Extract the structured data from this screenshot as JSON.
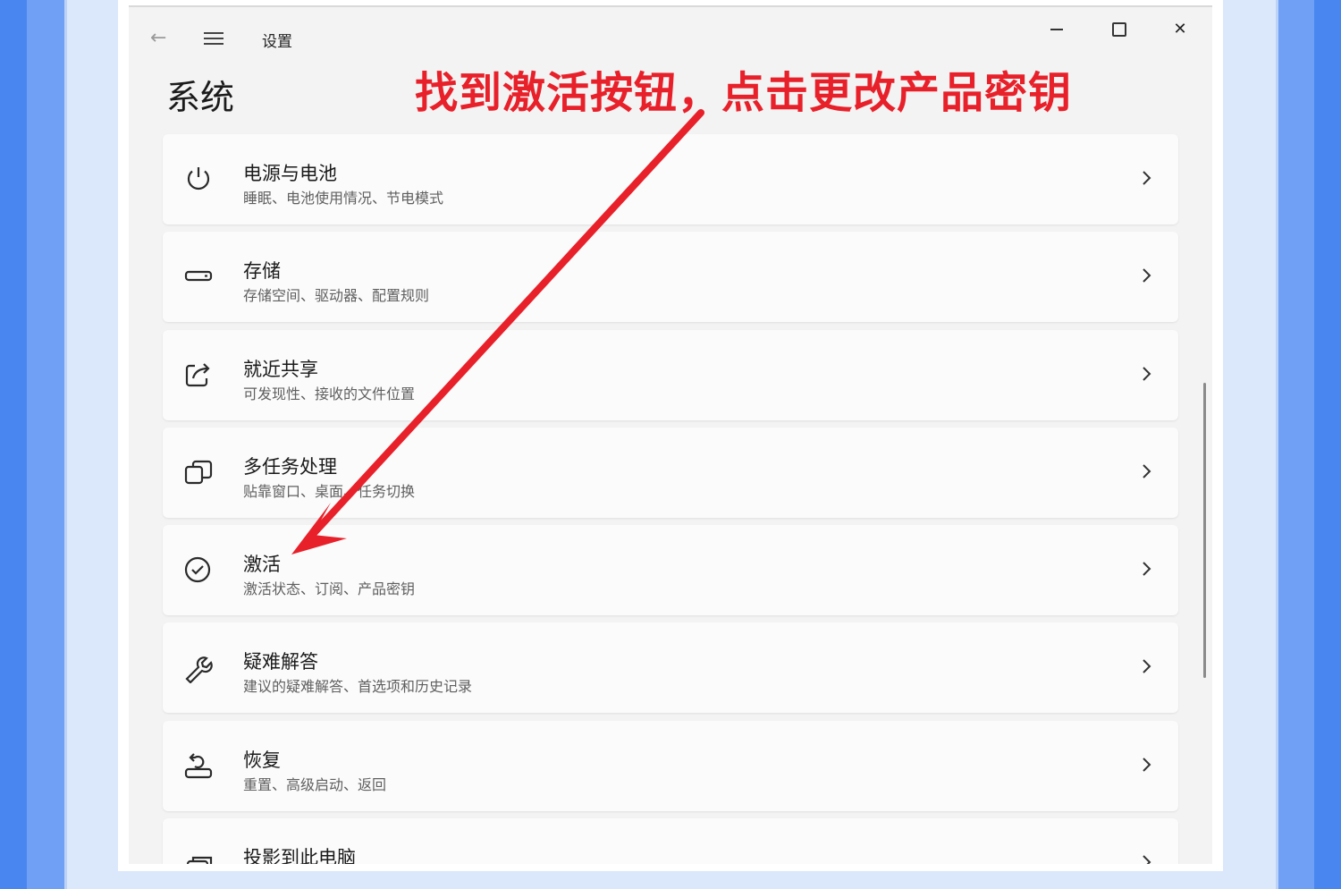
{
  "window": {
    "app_title": "设置",
    "page_title": "系统"
  },
  "annotation": {
    "text": "找到激活按钮，点击更改产品密钥",
    "color": "#e8202a"
  },
  "items": [
    {
      "title": "电源与电池",
      "subtitle": "睡眠、电池使用情况、节电模式",
      "icon": "power-icon"
    },
    {
      "title": "存储",
      "subtitle": "存储空间、驱动器、配置规则",
      "icon": "storage-icon"
    },
    {
      "title": "就近共享",
      "subtitle": "可发现性、接收的文件位置",
      "icon": "share-icon"
    },
    {
      "title": "多任务处理",
      "subtitle": "贴靠窗口、桌面、任务切换",
      "icon": "multitask-icon"
    },
    {
      "title": "激活",
      "subtitle": "激活状态、订阅、产品密钥",
      "icon": "check-circle-icon"
    },
    {
      "title": "疑难解答",
      "subtitle": "建议的疑难解答、首选项和历史记录",
      "icon": "wrench-icon"
    },
    {
      "title": "恢复",
      "subtitle": "重置、高级启动、返回",
      "icon": "recovery-icon"
    },
    {
      "title": "投影到此电脑",
      "subtitle": "",
      "icon": "project-icon"
    }
  ]
}
